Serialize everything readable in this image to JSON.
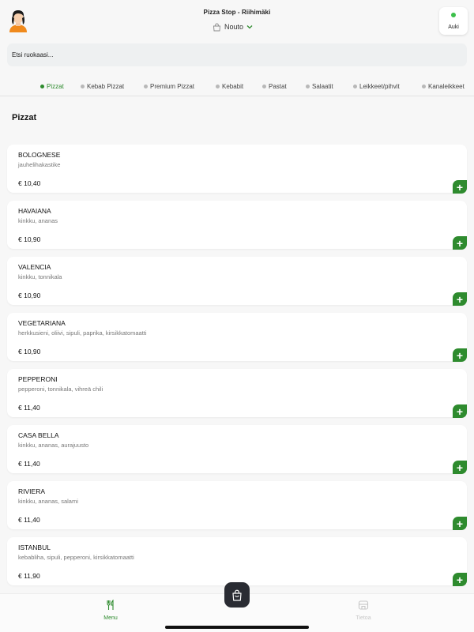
{
  "header": {
    "store_title": "Pizza Stop - Riihimäki",
    "mode_label": "Nouto",
    "status_label": "Auki",
    "status_color": "#3cbf4a"
  },
  "search": {
    "placeholder": "Etsi ruokaasi..."
  },
  "categories": [
    {
      "label": "Pizzat",
      "active": true
    },
    {
      "label": "Kebab Pizzat",
      "active": false
    },
    {
      "label": "Premium Pizzat",
      "active": false
    },
    {
      "label": "Kebabit",
      "active": false
    },
    {
      "label": "Pastat",
      "active": false
    },
    {
      "label": "Salaatit",
      "active": false
    },
    {
      "label": "Leikkeet/pihvit",
      "active": false
    },
    {
      "label": "Kanaleikkeet",
      "active": false
    }
  ],
  "section": {
    "title": "Pizzat"
  },
  "items": [
    {
      "name": "BOLOGNESE",
      "description": "jauhelihakastike",
      "price": "€ 10,40"
    },
    {
      "name": "HAVAIANA",
      "description": "kinkku, ananas",
      "price": "€ 10,90"
    },
    {
      "name": "VALENCIA",
      "description": "kinkku, tonnikala",
      "price": "€ 10,90"
    },
    {
      "name": "VEGETARIANA",
      "description": "herkkusieni, oliivi, sipuli, paprika, kirsikkatomaatti",
      "price": "€ 10,90"
    },
    {
      "name": "PEPPERONI",
      "description": "pepperoni, tonnikala, vihreä chili",
      "price": "€ 11,40"
    },
    {
      "name": "CASA BELLA",
      "description": "kinkku, ananas, aurajuusto",
      "price": "€ 11,40"
    },
    {
      "name": "RIVIERA",
      "description": "kinkku, ananas, salami",
      "price": "€ 11,40"
    },
    {
      "name": "ISTANBUL",
      "description": "kebabliha, sipuli, pepperoni, kirsikkatomaatti",
      "price": "€ 11,90"
    }
  ],
  "add_label": "+",
  "bottom_nav": {
    "menu_label": "Menu",
    "info_label": "Tietoa"
  },
  "colors": {
    "accent": "#2e8b2e",
    "cart_button": "#2a2c33"
  },
  "icons": {
    "avatar": "avatar-icon",
    "mode": "bag-icon",
    "cart": "cart-bag-icon",
    "menu": "fork-knife-icon",
    "info": "store-icon"
  }
}
